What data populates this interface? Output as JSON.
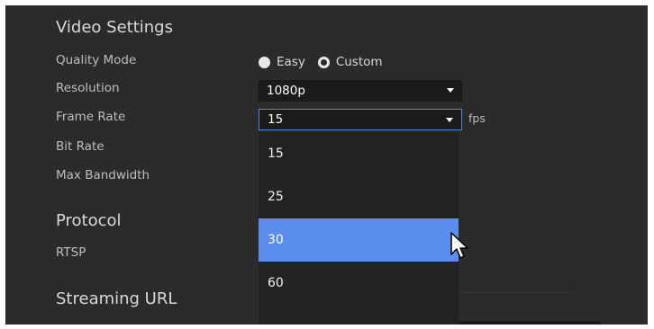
{
  "video_settings": {
    "title": "Video Settings",
    "quality_mode": {
      "label": "Quality Mode",
      "options": [
        "Easy",
        "Custom"
      ],
      "selected": "Custom"
    },
    "resolution": {
      "label": "Resolution",
      "value": "1080p"
    },
    "frame_rate": {
      "label": "Frame Rate",
      "value": "15",
      "unit": "fps",
      "options": [
        "15",
        "25",
        "30",
        "60"
      ],
      "highlighted": "30"
    },
    "bit_rate": {
      "label": "Bit Rate"
    },
    "max_bandwidth": {
      "label": "Max Bandwidth"
    }
  },
  "protocol": {
    "title": "Protocol",
    "rtsp_label": "RTSP"
  },
  "streaming_url": {
    "title": "Streaming URL"
  },
  "colors": {
    "panel_bg": "#2b2b2b",
    "field_bg": "#1b1b1b",
    "accent": "#5b8def",
    "focus_border": "#4f86d8"
  },
  "icons": {
    "select_caret": "caret-down-icon",
    "pointer": "mouse-cursor-icon"
  }
}
